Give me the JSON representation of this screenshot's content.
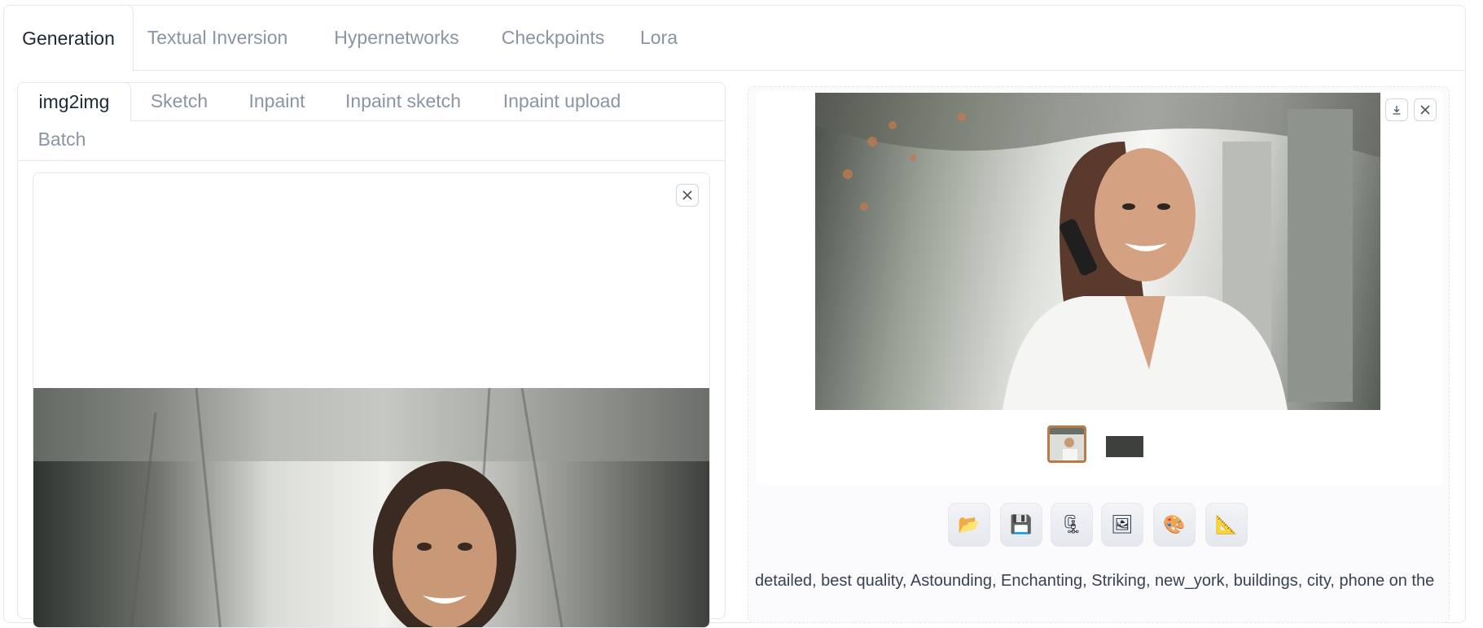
{
  "top_tabs": [
    {
      "label": "Generation",
      "active": true
    },
    {
      "label": "Textual Inversion",
      "active": false
    },
    {
      "label": "Hypernetworks",
      "active": false
    },
    {
      "label": "Checkpoints",
      "active": false
    },
    {
      "label": "Lora",
      "active": false
    }
  ],
  "mode_tabs": [
    {
      "label": "img2img",
      "active": true
    },
    {
      "label": "Sketch",
      "active": false
    },
    {
      "label": "Inpaint",
      "active": false
    },
    {
      "label": "Inpaint sketch",
      "active": false
    },
    {
      "label": "Inpaint upload",
      "active": false
    },
    {
      "label": "Batch",
      "active": false
    }
  ],
  "output": {
    "caption": "detailed, best quality, Astounding, Enchanting, Striking, new_york, buildings, city, phone on the",
    "thumbnails": [
      "generated-image",
      "mask-image"
    ],
    "tools": [
      {
        "name": "open-folder-icon",
        "glyph": "📂"
      },
      {
        "name": "save-icon",
        "glyph": "💾"
      },
      {
        "name": "zip-icon",
        "glyph": "🗜"
      },
      {
        "name": "send-to-img2img-icon",
        "glyph": "🖼"
      },
      {
        "name": "send-to-inpaint-icon",
        "glyph": "🎨"
      },
      {
        "name": "send-to-extras-icon",
        "glyph": "📐"
      }
    ]
  },
  "colors": {
    "accent": "#b97a4a",
    "border": "#e5e7eb",
    "inactive_text": "#8a94a3"
  }
}
